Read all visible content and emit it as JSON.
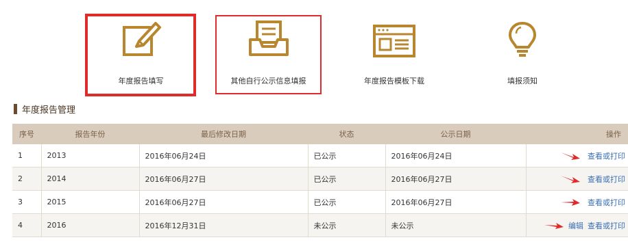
{
  "tiles": [
    {
      "label": "年度报告填写",
      "icon": "pencil-edit-icon"
    },
    {
      "label": "其他自行公示信息填报",
      "icon": "inbox-tray-icon"
    },
    {
      "label": "年度报告模板下载",
      "icon": "template-window-icon"
    },
    {
      "label": "填报须知",
      "icon": "lightbulb-icon"
    }
  ],
  "section": {
    "title": "年度报告管理"
  },
  "table": {
    "headers": [
      "序号",
      "报告年份",
      "最后修改日期",
      "状态",
      "公示日期",
      "操作"
    ],
    "rows": [
      {
        "no": "1",
        "year": "2013",
        "modified": "2016年06月24日",
        "status": "已公示",
        "publish": "2016年06月24日",
        "edit": "",
        "view": "查看或打印"
      },
      {
        "no": "2",
        "year": "2014",
        "modified": "2016年06月27日",
        "status": "已公示",
        "publish": "2016年06月27日",
        "edit": "",
        "view": "查看或打印"
      },
      {
        "no": "3",
        "year": "2015",
        "modified": "2016年06月27日",
        "status": "已公示",
        "publish": "2016年06月27日",
        "edit": "",
        "view": "查看或打印"
      },
      {
        "no": "4",
        "year": "2016",
        "modified": "2016年12月31日",
        "status": "未公示",
        "publish": "未公示",
        "edit": "编辑",
        "view": "查看或打印"
      }
    ]
  },
  "colors": {
    "accent": "#b8862e",
    "highlight": "#e02b2b",
    "header_bg": "#d9ccbd",
    "link": "#3a6fb5"
  }
}
